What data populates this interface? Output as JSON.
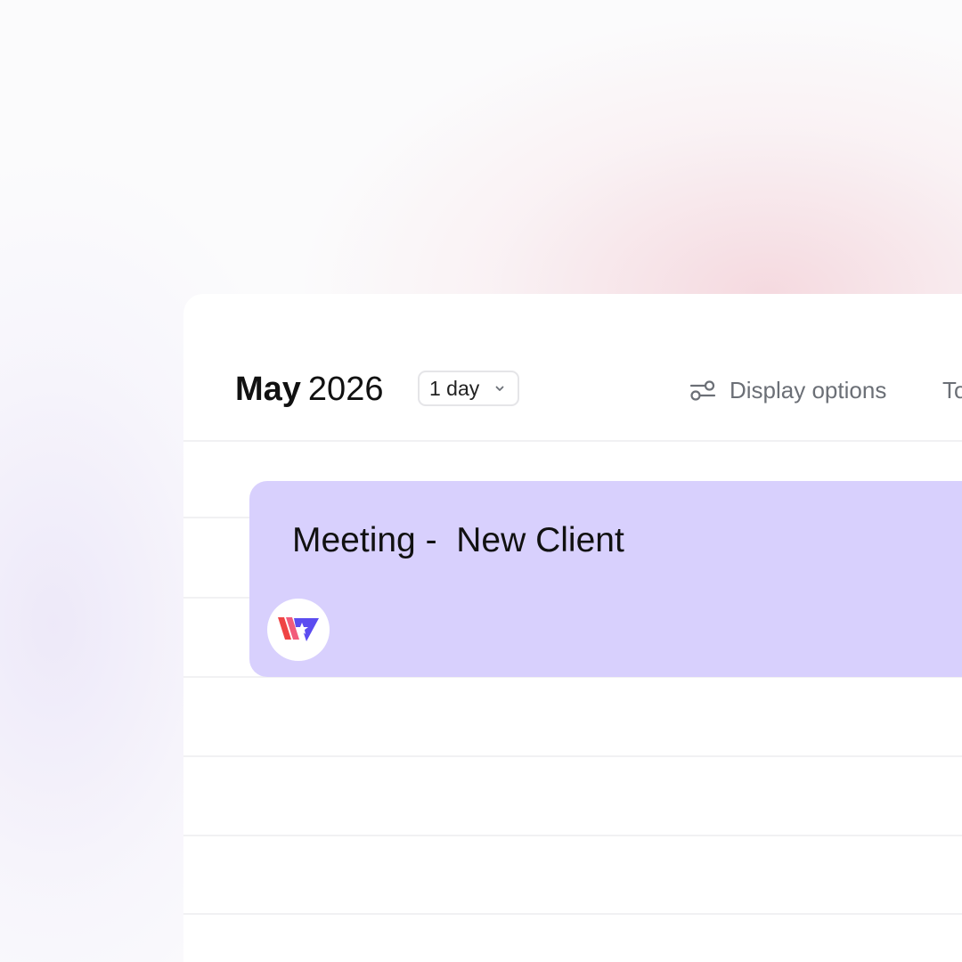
{
  "header": {
    "month": "May",
    "year": "2026",
    "view_select": {
      "value": "1 day",
      "icon": "chevron-down-icon"
    },
    "display_options": {
      "label": "Display options",
      "icon": "sliders-icon"
    },
    "today_label": "To"
  },
  "event": {
    "title": "Meeting -  New Client",
    "color": "#d8d0fd",
    "avatar_icon": "brand-logo-icon"
  },
  "colors": {
    "panel_background": "#ffffff",
    "muted_text": "#6b6f76",
    "grid_line": "#f1f1f3",
    "logo_red": "#ef4444",
    "logo_purple": "#5b4cf0"
  }
}
